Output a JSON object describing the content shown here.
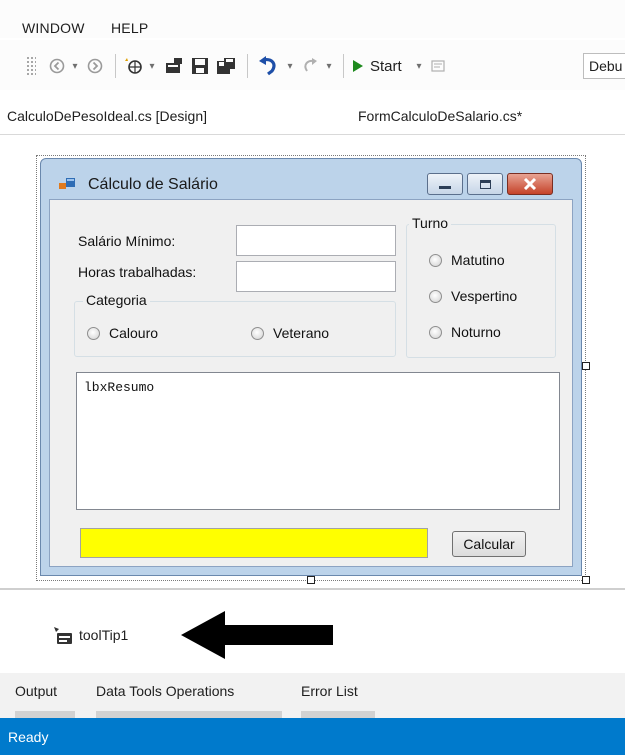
{
  "menu": {
    "items": [
      "WINDOW",
      "HELP"
    ]
  },
  "toolbar": {
    "icons": [
      "back-icon",
      "forward-icon",
      "new-project-icon",
      "open-icon",
      "save-icon",
      "save-all-icon",
      "undo-icon",
      "redo-icon",
      "start-icon",
      "attach-icon"
    ],
    "start_label": "Start",
    "config_value": "Debu",
    "colors": {
      "start_green": "#1e8a1e",
      "undo_blue": "#1e4fa8"
    }
  },
  "tabs": [
    {
      "label": "CalculoDePesoIdeal.cs [Design]"
    },
    {
      "label": "FormCalculoDeSalario.cs*"
    }
  ],
  "form": {
    "title": "Cálculo de Salário",
    "labels": {
      "salario": "Salário Mínimo:",
      "horas": "Horas trabalhadas:"
    },
    "inputs": {
      "salario_value": "",
      "horas_value": ""
    },
    "categoria": {
      "caption": "Categoria",
      "options": [
        "Calouro",
        "Veterano"
      ]
    },
    "turno": {
      "caption": "Turno",
      "options": [
        "Matutino",
        "Vespertino",
        "Noturno"
      ]
    },
    "listbox_text": "lbxResumo",
    "calc_button": "Calcular",
    "colors": {
      "result_box": "#ffff00",
      "window_frame": "#bcd3ea",
      "close_button": "#c5432a"
    }
  },
  "tray": {
    "component_label": "toolTip1",
    "component_icon": "tooltip-component-icon",
    "annotation": "arrow-left"
  },
  "bottom_tabs": [
    "Output",
    "Data Tools Operations",
    "Error List"
  ],
  "status": {
    "text": "Ready",
    "color": "#007acc"
  }
}
